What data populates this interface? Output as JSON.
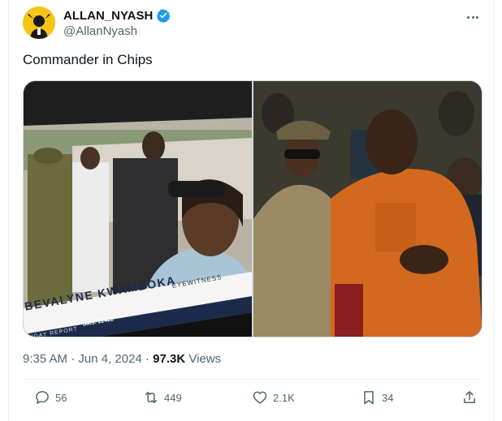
{
  "author": {
    "display_name": "ALLAN_NYASH",
    "handle": "@AllanNyash",
    "verified_color": "#1d9bf0",
    "avatar_bg": "#f5c518"
  },
  "tweet": {
    "text": "Commander in Chips",
    "time": "9:35 AM",
    "separator": "·",
    "date": "Jun 4, 2024",
    "separator2": "·",
    "views_count": "97.3K",
    "views_label": "Views"
  },
  "media_left": {
    "caption_name": "BEVALYNE KWAMBOKA",
    "caption_tag": "EYEWITNESS",
    "caption_sms": "SMS: 22422",
    "caption_report": "ONDAY REPORT"
  },
  "actions": {
    "replies": "56",
    "retweets": "449",
    "likes": "2.1K",
    "bookmarks": "34"
  },
  "icons": {
    "more": "more-horizontal-icon",
    "reply": "reply-icon",
    "retweet": "retweet-icon",
    "like": "heart-icon",
    "bookmark": "bookmark-icon",
    "share": "share-icon",
    "verified": "verified-badge-icon"
  }
}
